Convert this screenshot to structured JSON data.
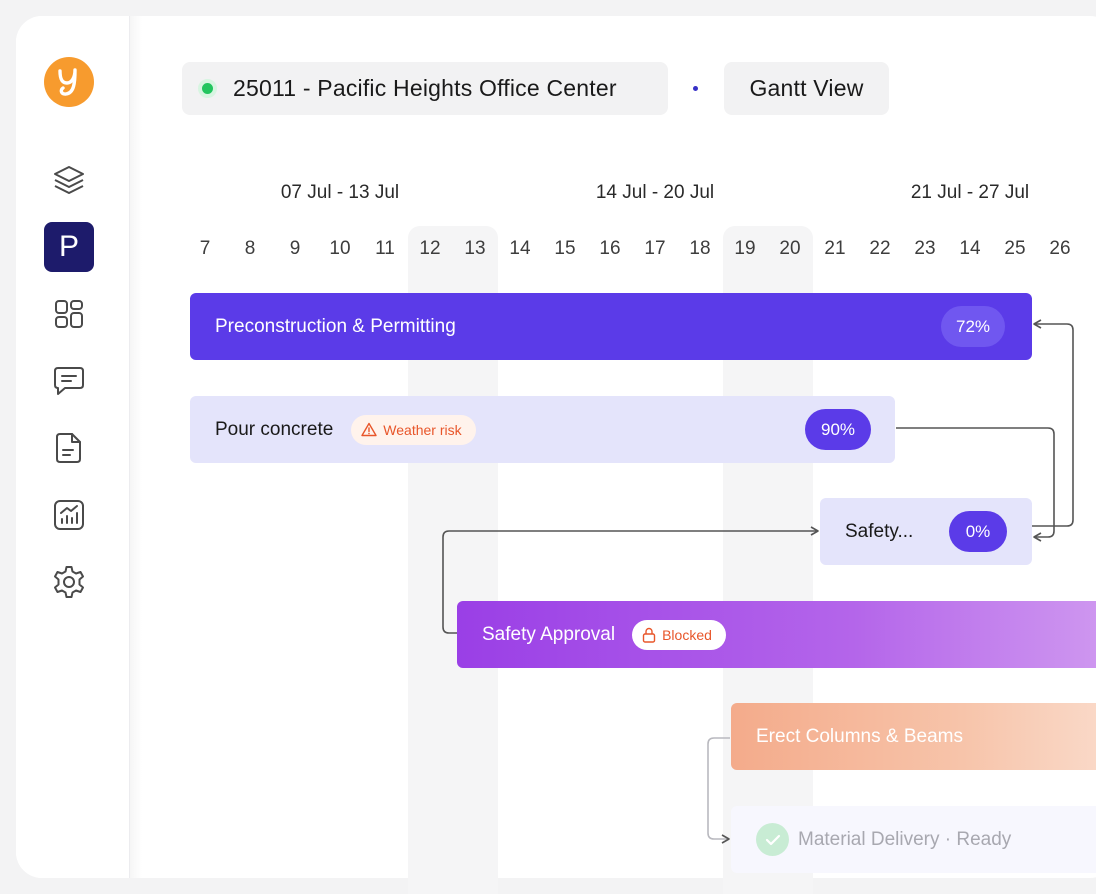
{
  "header": {
    "project_label": "25011 - Pacific Heights Office Center",
    "view_label": "Gantt View"
  },
  "timeline": {
    "weeks": [
      "07 Jul - 13 Jul",
      "14 Jul - 20 Jul",
      "21 Jul - 27 Jul"
    ],
    "days": [
      "7",
      "8",
      "9",
      "10",
      "11",
      "12",
      "13",
      "14",
      "15",
      "16",
      "17",
      "18",
      "19",
      "20",
      "21",
      "22",
      "23",
      "14",
      "25",
      "26"
    ]
  },
  "sidebar": {
    "items": [
      {
        "icon": "layers-icon"
      },
      {
        "icon": "project-icon",
        "label": "P",
        "active": true
      },
      {
        "icon": "dashboard-icon"
      },
      {
        "icon": "chat-icon"
      },
      {
        "icon": "document-icon"
      },
      {
        "icon": "analytics-icon"
      },
      {
        "icon": "gear-icon"
      }
    ]
  },
  "tasks": [
    {
      "name": "Preconstruction & Permitting",
      "progress_label": "72%"
    },
    {
      "name": "Pour concrete",
      "tag": "Weather risk",
      "progress_label": "90%"
    },
    {
      "name": "Safety...",
      "progress_label": "0%"
    },
    {
      "name": "Safety Approval",
      "tag": "Blocked"
    },
    {
      "name": "Erect Columns & Beams"
    },
    {
      "name": "Material Delivery · Ready"
    }
  ],
  "colors": {
    "accent": "#5b3be8",
    "logo": "#f79b2e",
    "active_nav": "#1d1b6b",
    "status_green": "#22c55e",
    "warning": "#e8562a"
  }
}
